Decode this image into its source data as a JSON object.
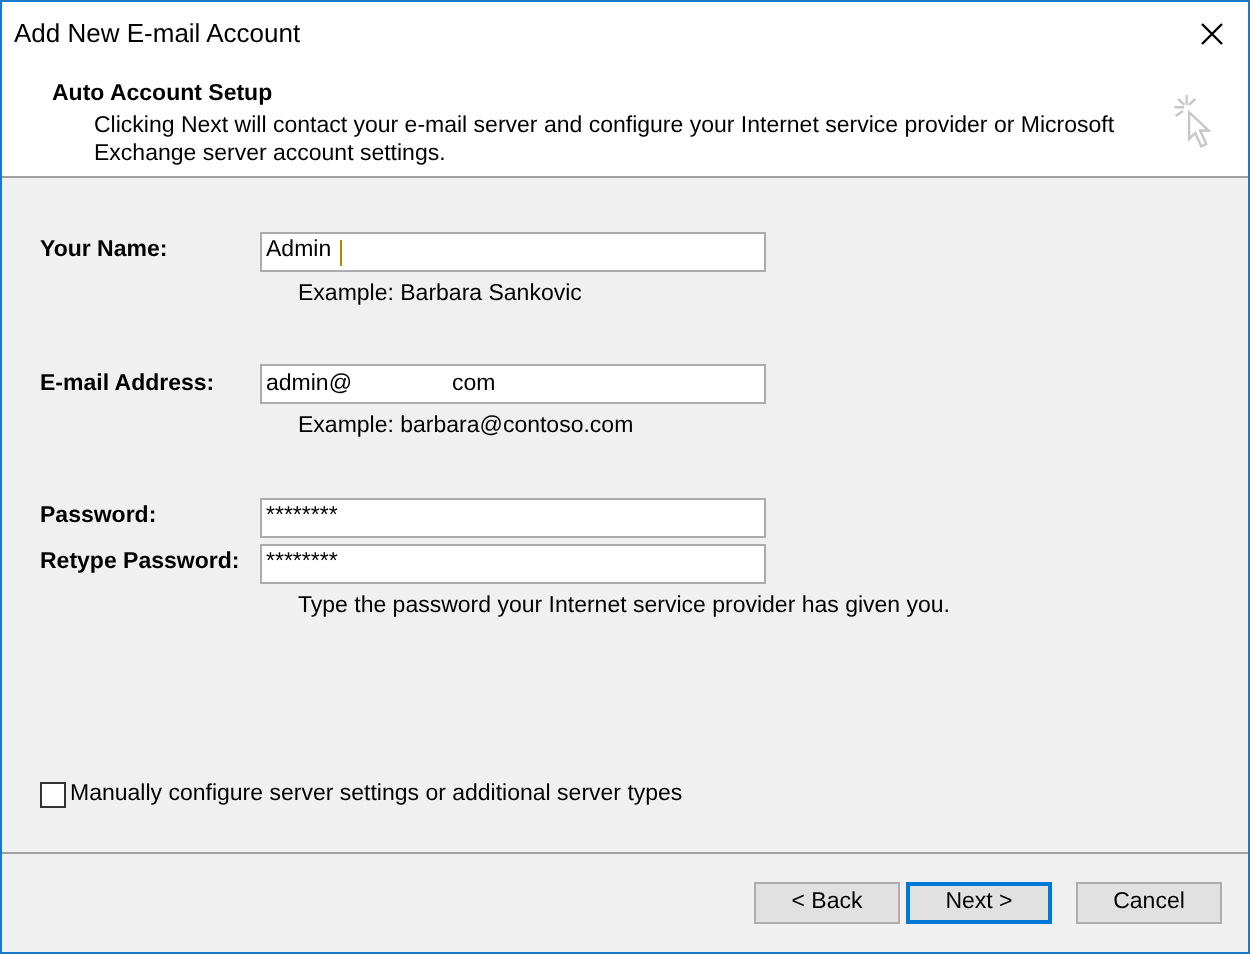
{
  "window": {
    "title": "Add New E-mail Account"
  },
  "header": {
    "title": "Auto Account Setup",
    "description": "Clicking Next will contact your e-mail server and configure your Internet service provider or Microsoft Exchange server account settings."
  },
  "fields": [
    {
      "label": "Your Name:",
      "value_parts": [
        "Admin"
      ],
      "focused": true,
      "hint": "Example: Barbara Sankovic"
    },
    {
      "label": "E-mail Address:",
      "value_parts": [
        "admin@",
        "com"
      ],
      "focused": false,
      "hint": "Example: barbara@contoso.com"
    },
    {
      "label": "Password:",
      "value_parts": [
        "********"
      ],
      "focused": false
    },
    {
      "label": "Retype Password:",
      "value_parts": [
        "********"
      ],
      "focused": false,
      "hint": "Type the password your Internet service provider has given you."
    }
  ],
  "manual_config": {
    "label": "Manually configure server settings or additional server types",
    "checked": false
  },
  "buttons": [
    {
      "label": "< Back",
      "default": false
    },
    {
      "label": "Next >",
      "default": true
    },
    {
      "label": "Cancel",
      "default": false
    }
  ]
}
